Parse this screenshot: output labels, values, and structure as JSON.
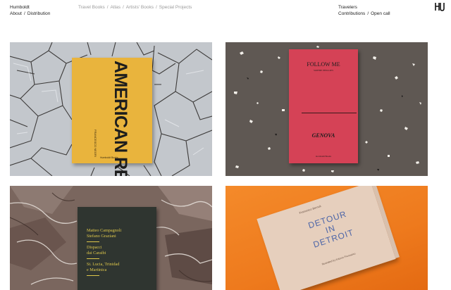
{
  "nav": {
    "brand": "Humboldt",
    "about": "About",
    "distribution": "Distribution",
    "sep": "/",
    "categories": [
      "Travel Books",
      "Atlas",
      "Artists' Books",
      "Special Projects"
    ],
    "travelers": "Travelers",
    "contributions": "Contributions",
    "open_call": "Open call",
    "logo": "HU"
  },
  "books": [
    {
      "title": "AMERICAN RECORDINGS",
      "author": "FRANCESCO NEGRI",
      "publisher": "Humboldt Books",
      "cover_color": "#e9b43d",
      "background": "cracked-earth"
    },
    {
      "title": "FOLLOW ME",
      "author": "SOPHIE PHILLIPS",
      "subtitle": "GENOVA",
      "publisher": "Humboldt Books",
      "cover_color": "#d54256",
      "background": "terrazzo"
    },
    {
      "lines": [
        "Matteo Campagnoli",
        "Stefano Graziani",
        "Dispacci",
        "dai Caraibi",
        "St. Lucia, Trinidad",
        "e Martinica"
      ],
      "cover_color": "#2f3530",
      "background": "marble"
    },
    {
      "author": "Francesco Bernoli",
      "title_lines": [
        "DETOUR",
        "IN",
        "DETROIT"
      ],
      "credit": "Illustrated by Antonio Pronostico",
      "cover_color": "#e6cfbd",
      "background": "orange"
    }
  ]
}
